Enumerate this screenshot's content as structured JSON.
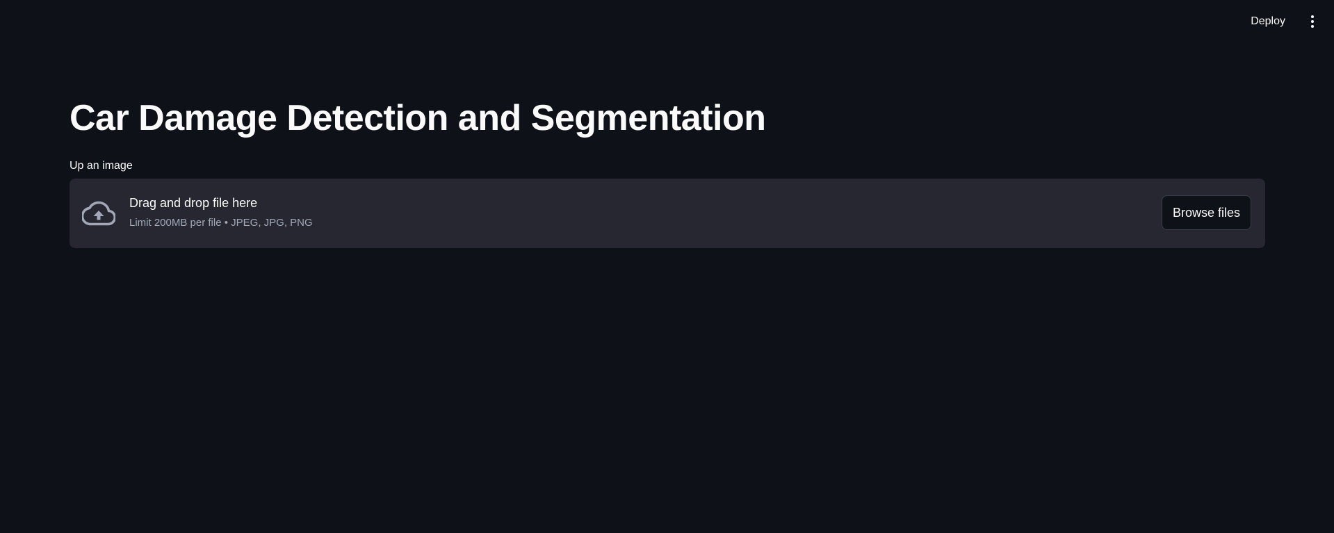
{
  "header": {
    "deploy_label": "Deploy",
    "menu_icon": "vertical-ellipsis-icon"
  },
  "main": {
    "title": "Car Damage Detection and Segmentation",
    "uploader": {
      "label": "Up an image",
      "icon": "cloud-upload-icon",
      "drop_text": "Drag and drop file here",
      "limit_text": "Limit 200MB per file • JPEG, JPG, PNG",
      "browse_label": "Browse files"
    }
  },
  "colors": {
    "background": "#0e1117",
    "dropzone": "#262730",
    "text": "#fafafa",
    "muted_text": "#a3a8b8"
  }
}
